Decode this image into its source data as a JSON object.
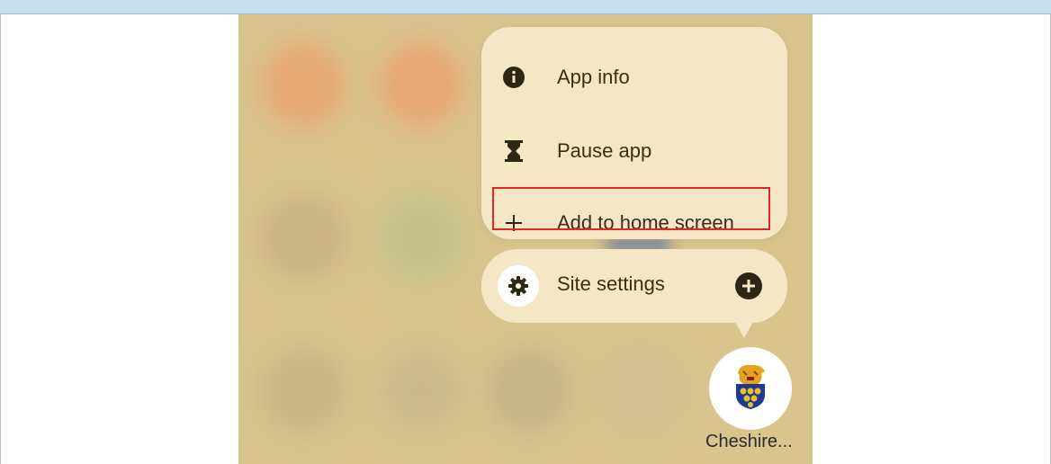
{
  "menu": {
    "items": [
      {
        "label": "App info",
        "icon": "info-icon"
      },
      {
        "label": "Pause app",
        "icon": "hourglass-icon"
      },
      {
        "label": "Add to home screen",
        "icon": "plus-icon"
      }
    ]
  },
  "site_settings": {
    "label": "Site settings",
    "icon": "gear-icon",
    "action_icon": "add-circle-icon"
  },
  "app": {
    "label": "Cheshire...",
    "icon": "cheshire-logo-icon"
  },
  "colors": {
    "wallpaper": "#d9c48e",
    "menu_bg": "#f5e7c6",
    "highlight": "#e4252b",
    "text": "#3a2e17"
  }
}
